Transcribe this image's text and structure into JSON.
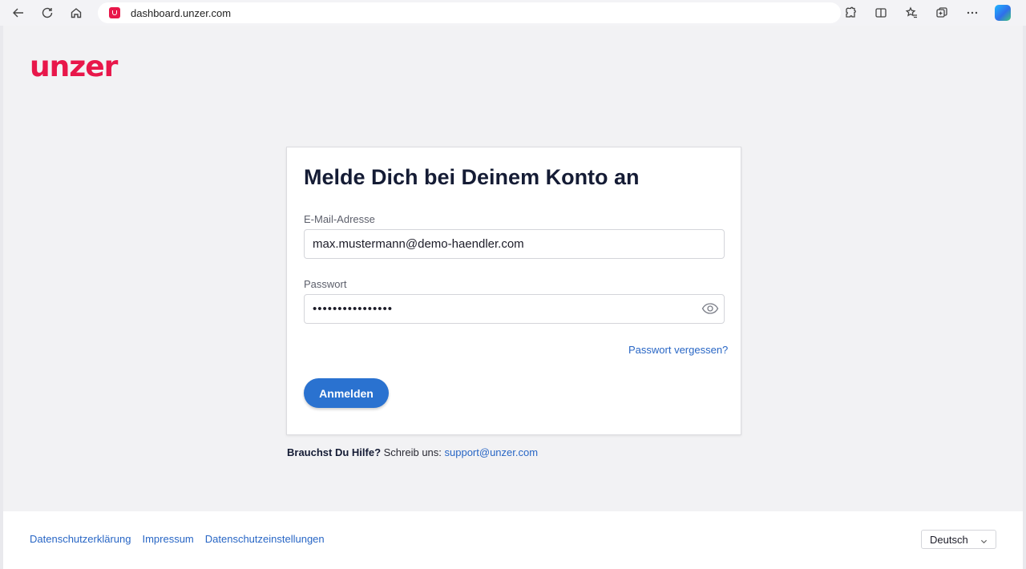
{
  "browser": {
    "url": "dashboard.unzer.com"
  },
  "brand": {
    "logo_text": "unzer",
    "color": "#e8174a"
  },
  "login": {
    "title": "Melde Dich bei Deinem Konto an",
    "email_label": "E-Mail-Adresse",
    "email_value": "max.mustermann@demo-haendler.com",
    "password_label": "Passwort",
    "password_value": "••••••••••••••••",
    "forgot_link": "Passwort vergessen?",
    "submit_label": "Anmelden",
    "accent_color": "#2a72d0"
  },
  "help": {
    "prefix": "Brauchst Du Hilfe?",
    "text": " Schreib uns: ",
    "email": "support@unzer.com"
  },
  "footer": {
    "links": [
      "Datenschutzerklärung",
      "Impressum",
      "Datenschutzeinstellungen"
    ],
    "language": "Deutsch"
  },
  "icons": [
    "back-icon",
    "refresh-icon",
    "home-icon",
    "extensions-icon",
    "split-screen-icon",
    "favorites-icon",
    "collections-icon",
    "more-icon",
    "copilot-icon",
    "eye-icon",
    "chevron-down-icon"
  ]
}
